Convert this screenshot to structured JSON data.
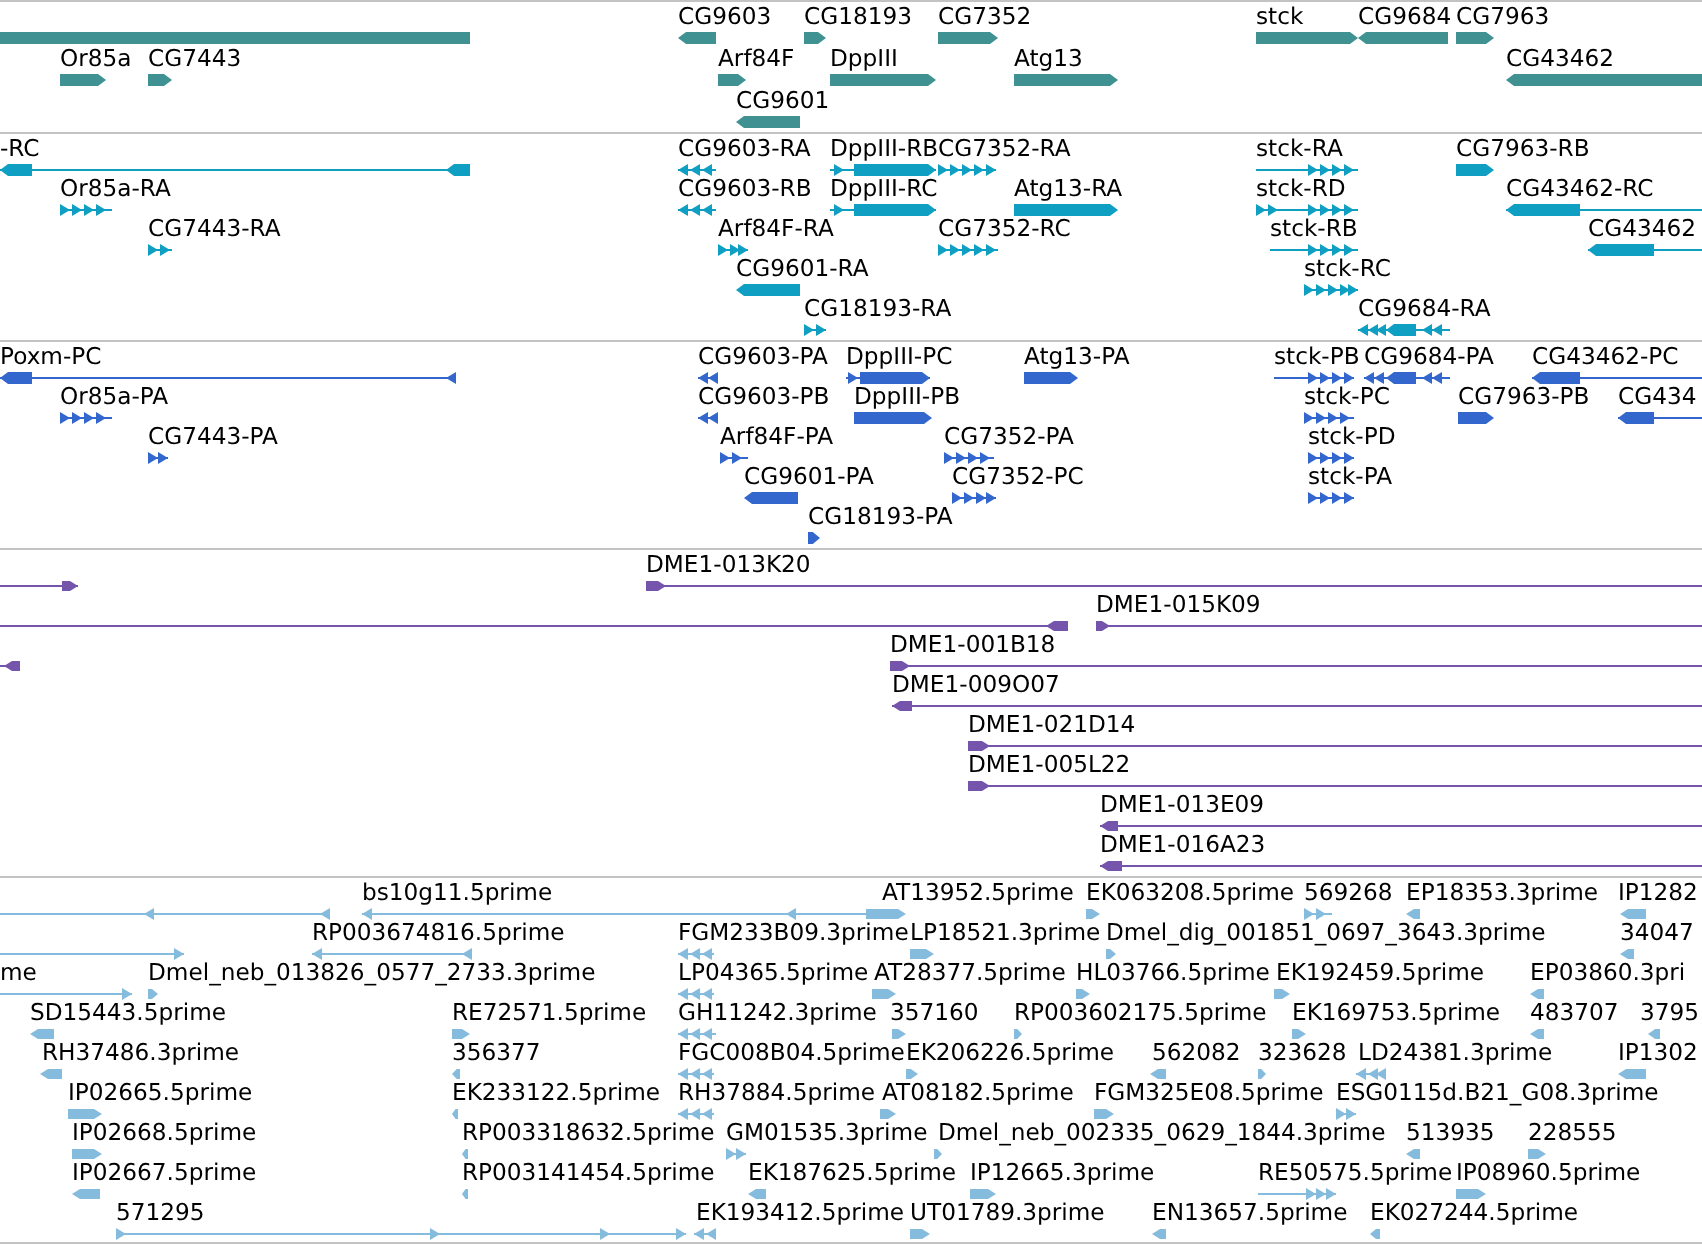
{
  "tracks": [
    {
      "kind": "genes",
      "features": [
        {
          "kind": "block"
        },
        {
          "label": "Or85a",
          "kind": "bar",
          "reverse": false
        },
        {
          "label": "CG7443",
          "kind": "bar",
          "reverse": false
        },
        {
          "label": "CG9603",
          "kind": "bar",
          "reverse": true
        },
        {
          "label": "Arf84F",
          "kind": "bar",
          "reverse": false
        },
        {
          "label": "CG9601",
          "kind": "bar",
          "reverse": true
        },
        {
          "label": "CG18193",
          "kind": "bar",
          "reverse": false
        },
        {
          "label": "DppIII",
          "kind": "bar",
          "reverse": false
        },
        {
          "label": "CG7352",
          "kind": "bar",
          "reverse": false
        },
        {
          "label": "Atg13",
          "kind": "bar",
          "reverse": false
        },
        {
          "label": "stck",
          "kind": "bar",
          "reverse": false
        },
        {
          "label": "CG9684",
          "kind": "bar",
          "reverse": true
        },
        {
          "label": "CG7963",
          "kind": "bar",
          "reverse": false
        },
        {
          "label": "CG43462",
          "kind": "bar",
          "reverse": true
        }
      ]
    },
    {
      "kind": "transcripts",
      "features": [
        {
          "label": "-RC",
          "kind": "line",
          "reverse": true
        },
        {
          "label": "CG9603-RA",
          "kind": "chevrons",
          "reverse": true
        },
        {
          "label": "DppIII-RB",
          "kind": "line",
          "reverse": false
        },
        {
          "label": "CG7352-RA",
          "kind": "chevrons",
          "reverse": false
        },
        {
          "label": "stck-RA",
          "kind": "line",
          "reverse": false
        },
        {
          "label": "CG7963-RB",
          "kind": "bar",
          "reverse": false
        },
        {
          "label": "Or85a-RA",
          "kind": "chevrons",
          "reverse": false
        },
        {
          "label": "CG9603-RB",
          "kind": "chevrons",
          "reverse": true
        },
        {
          "label": "DppIII-RC",
          "kind": "line",
          "reverse": false
        },
        {
          "label": "Atg13-RA",
          "kind": "bar",
          "reverse": false
        },
        {
          "label": "stck-RD",
          "kind": "line",
          "reverse": false
        },
        {
          "label": "CG43462-RC",
          "kind": "line",
          "reverse": true
        },
        {
          "label": "CG7443-RA",
          "kind": "chevrons",
          "reverse": false
        },
        {
          "label": "Arf84F-RA",
          "kind": "chevrons",
          "reverse": false
        },
        {
          "label": "CG7352-RC",
          "kind": "chevrons",
          "reverse": false
        },
        {
          "label": "stck-RB",
          "kind": "line",
          "reverse": false
        },
        {
          "label": "CG43462",
          "kind": "line",
          "reverse": true
        },
        {
          "label": "CG9601-RA",
          "kind": "bar",
          "reverse": true
        },
        {
          "label": "stck-RC",
          "kind": "chevrons",
          "reverse": false
        },
        {
          "label": "CG18193-RA",
          "kind": "chevrons",
          "reverse": false
        },
        {
          "label": "CG9684-RA",
          "kind": "line",
          "reverse": true
        }
      ]
    },
    {
      "kind": "proteins",
      "features": [
        {
          "label": "Poxm-PC",
          "kind": "line",
          "reverse": true
        },
        {
          "label": "CG9603-PA",
          "kind": "chevrons",
          "reverse": true
        },
        {
          "label": "DppIII-PC",
          "kind": "line",
          "reverse": false
        },
        {
          "label": "Atg13-PA",
          "kind": "bar",
          "reverse": false
        },
        {
          "label": "stck-PB",
          "kind": "line",
          "reverse": false
        },
        {
          "label": "CG9684-PA",
          "kind": "line",
          "reverse": true
        },
        {
          "label": "CG43462-PC",
          "kind": "line",
          "reverse": true
        },
        {
          "label": "Or85a-PA",
          "kind": "chevrons",
          "reverse": false
        },
        {
          "label": "CG9603-PB",
          "kind": "chevrons",
          "reverse": true
        },
        {
          "label": "DppIII-PB",
          "kind": "bar",
          "reverse": false
        },
        {
          "label": "stck-PC",
          "kind": "chevrons",
          "reverse": false
        },
        {
          "label": "CG7963-PB",
          "kind": "bar",
          "reverse": false
        },
        {
          "label": "CG434",
          "kind": "line",
          "reverse": true
        },
        {
          "label": "CG7443-PA",
          "kind": "chevrons",
          "reverse": false
        },
        {
          "label": "Arf84F-PA",
          "kind": "chevrons",
          "reverse": false
        },
        {
          "label": "CG7352-PA",
          "kind": "chevrons",
          "reverse": false
        },
        {
          "label": "stck-PD",
          "kind": "chevrons",
          "reverse": false
        },
        {
          "label": "CG9601-PA",
          "kind": "bar",
          "reverse": true
        },
        {
          "label": "CG7352-PC",
          "kind": "chevrons",
          "reverse": false
        },
        {
          "label": "stck-PA",
          "kind": "chevrons",
          "reverse": false
        },
        {
          "label": "CG18193-PA",
          "kind": "bar",
          "reverse": false
        }
      ]
    },
    {
      "kind": "clones",
      "features": [
        {
          "kind": "line",
          "reverse": false
        },
        {
          "label": "DME1-013K20",
          "kind": "line",
          "reverse": false
        },
        {
          "kind": "line",
          "reverse": true
        },
        {
          "label": "DME1-015K09",
          "kind": "line",
          "reverse": false
        },
        {
          "kind": "line",
          "reverse": true
        },
        {
          "label": "DME1-001B18",
          "kind": "line",
          "reverse": false
        },
        {
          "label": "DME1-009O07",
          "kind": "line",
          "reverse": true
        },
        {
          "label": "DME1-021D14",
          "kind": "line",
          "reverse": false
        },
        {
          "label": "DME1-005L22",
          "kind": "line",
          "reverse": false
        },
        {
          "label": "DME1-013E09",
          "kind": "line",
          "reverse": true
        },
        {
          "label": "DME1-016A23",
          "kind": "line",
          "reverse": true
        }
      ]
    },
    {
      "kind": "ests",
      "features": [
        {
          "kind": "line",
          "reverse": true
        },
        {
          "label": "bs10g11.5prime",
          "kind": "line",
          "reverse": true
        },
        {
          "label": "AT13952.5prime",
          "kind": "bar",
          "reverse": false
        },
        {
          "label": "EK063208.5prime",
          "kind": "bar",
          "reverse": false
        },
        {
          "label": "569268",
          "kind": "chevrons",
          "reverse": false
        },
        {
          "label": "EP18353.3prime",
          "kind": "bar",
          "reverse": true
        },
        {
          "label": "IP1282",
          "kind": "bar",
          "reverse": true
        },
        {
          "kind": "line",
          "reverse": false
        },
        {
          "label": "RP003674816.5prime",
          "kind": "line",
          "reverse": true
        },
        {
          "label": "FGM233B09.3prime",
          "kind": "chevrons",
          "reverse": true
        },
        {
          "label": "LP18521.3prime",
          "kind": "bar",
          "reverse": false
        },
        {
          "label": "Dmel_dig_001851_0697_3643.3prime",
          "kind": "bar",
          "reverse": false
        },
        {
          "label": "34047",
          "kind": "bar",
          "reverse": true
        },
        {
          "label": "me",
          "kind": "line",
          "reverse": false
        },
        {
          "label": "Dmel_neb_013826_0577_2733.3prime",
          "kind": "bar",
          "reverse": false
        },
        {
          "label": "LP04365.5prime",
          "kind": "chevrons",
          "reverse": true
        },
        {
          "label": "AT28377.5prime",
          "kind": "bar",
          "reverse": false
        },
        {
          "label": "HL03766.5prime",
          "kind": "bar",
          "reverse": false
        },
        {
          "label": "EK192459.5prime",
          "kind": "bar",
          "reverse": false
        },
        {
          "label": "EP03860.3pri",
          "kind": "bar",
          "reverse": true
        },
        {
          "label": "SD15443.5prime",
          "kind": "bar",
          "reverse": true
        },
        {
          "label": "RE72571.5prime",
          "kind": "bar",
          "reverse": false
        },
        {
          "label": "GH11242.3prime",
          "kind": "chevrons",
          "reverse": true
        },
        {
          "label": "357160",
          "kind": "bar",
          "reverse": false
        },
        {
          "label": "RP003602175.5prime",
          "kind": "bar",
          "reverse": false
        },
        {
          "label": "EK169753.5prime",
          "kind": "bar",
          "reverse": false
        },
        {
          "label": "483707",
          "kind": "bar",
          "reverse": true
        },
        {
          "label": "3795",
          "kind": "bar",
          "reverse": true
        },
        {
          "label": "RH37486.3prime",
          "kind": "bar",
          "reverse": true
        },
        {
          "label": "356377",
          "kind": "bar",
          "reverse": true
        },
        {
          "label": "FGC008B04.5prime",
          "kind": "chevrons",
          "reverse": true
        },
        {
          "label": "EK206226.5prime",
          "kind": "bar",
          "reverse": false
        },
        {
          "label": "562082",
          "kind": "bar",
          "reverse": true
        },
        {
          "label": "323628",
          "kind": "bar",
          "reverse": false
        },
        {
          "label": "LD24381.3prime",
          "kind": "chevrons",
          "reverse": true
        },
        {
          "label": "IP1302",
          "kind": "bar",
          "reverse": true
        },
        {
          "label": "IP02665.5prime",
          "kind": "bar",
          "reverse": false
        },
        {
          "label": "EK233122.5prime",
          "kind": "bar",
          "reverse": true
        },
        {
          "label": "RH37884.5prime",
          "kind": "chevrons",
          "reverse": true
        },
        {
          "label": "AT08182.5prime",
          "kind": "bar",
          "reverse": false
        },
        {
          "label": "FGM325E08.5prime",
          "kind": "bar",
          "reverse": false
        },
        {
          "label": "ESG0115d.B21_G08.3prime",
          "kind": "chevrons",
          "reverse": false
        },
        {
          "label": "IP02668.5prime",
          "kind": "bar",
          "reverse": false
        },
        {
          "label": "RP003318632.5prime",
          "kind": "bar",
          "reverse": true
        },
        {
          "label": "GM01535.3prime",
          "kind": "chevrons",
          "reverse": false
        },
        {
          "label": "Dmel_neb_002335_0629_1844.3prime",
          "kind": "bar",
          "reverse": false
        },
        {
          "label": "513935",
          "kind": "bar",
          "reverse": true
        },
        {
          "label": "228555",
          "kind": "bar",
          "reverse": false
        },
        {
          "label": "IP02667.5prime",
          "kind": "bar",
          "reverse": true
        },
        {
          "label": "RP003141454.5prime",
          "kind": "bar",
          "reverse": true
        },
        {
          "label": "EK187625.5prime",
          "kind": "bar",
          "reverse": true
        },
        {
          "label": "IP12665.3prime",
          "kind": "bar",
          "reverse": false
        },
        {
          "label": "RE50575.5prime",
          "kind": "line",
          "reverse": false
        },
        {
          "label": "IP08960.5prime",
          "kind": "bar",
          "reverse": false
        },
        {
          "label": "571295",
          "kind": "line",
          "reverse": false
        },
        {
          "label": "EK193412.5prime",
          "kind": "chevrons",
          "reverse": true
        },
        {
          "label": "UT01789.3prime",
          "kind": "bar",
          "reverse": false
        },
        {
          "label": "EN13657.5prime",
          "kind": "bar",
          "reverse": true
        },
        {
          "label": "EK027244.5prime",
          "kind": "bar",
          "reverse": true
        }
      ]
    }
  ]
}
